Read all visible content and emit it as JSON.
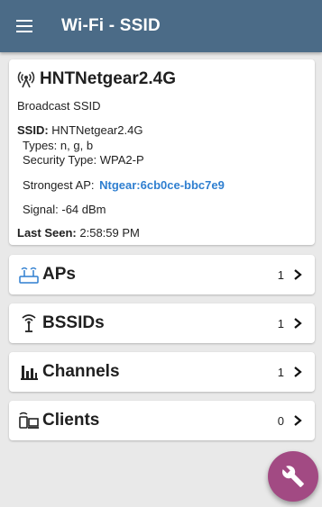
{
  "appbar": {
    "title": "Wi-Fi - SSID"
  },
  "summary": {
    "ssid_name": "HNTNetgear2.4G",
    "subtitle": "Broadcast SSID",
    "ssid_label": "SSID:",
    "ssid_value": "HNTNetgear2.4G",
    "types_label": "Types:",
    "types_value": "n, g, b",
    "security_label": "Security Type:",
    "security_value": "WPA2-P",
    "strongest_label": "Strongest AP:",
    "strongest_value": "Ntgear:6cb0ce-bbc7e9",
    "signal_label": "Signal:",
    "signal_value": "-64 dBm",
    "last_seen_label": "Last Seen:",
    "last_seen_value": "2:58:59 PM"
  },
  "rows": [
    {
      "label": "APs",
      "count": "1",
      "icon": "access-point-icon"
    },
    {
      "label": "BSSIDs",
      "count": "1",
      "icon": "antenna-icon"
    },
    {
      "label": "Channels",
      "count": "1",
      "icon": "bar-chart-icon"
    },
    {
      "label": "Clients",
      "count": "0",
      "icon": "clients-icon"
    }
  ],
  "fab": {
    "icon": "wrench-icon"
  },
  "colors": {
    "appbar": "#4b6b87",
    "link": "#2f7fd0",
    "fab": "#a24a83",
    "background": "#e9e9e9"
  }
}
